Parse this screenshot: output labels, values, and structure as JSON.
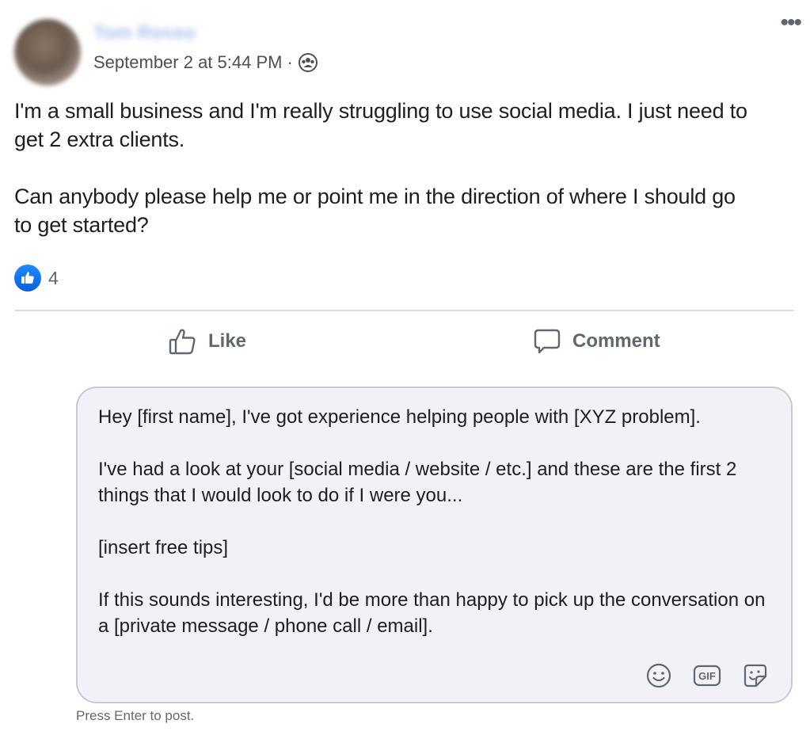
{
  "post": {
    "author_name": "Tom Rosso",
    "timestamp": "September 2 at 5:44 PM",
    "separator": "·",
    "audience_icon": "group-icon",
    "more_label": "•••",
    "paragraphs": [
      "I'm a small business and I'm really struggling to use social media. I just need to get 2 extra clients.",
      "Can anybody please help me or point me in the direction of where I should go to get started?"
    ],
    "reaction_count": "4",
    "reaction_icon": "like-reaction-icon"
  },
  "actions": {
    "like_label": "Like",
    "comment_label": "Comment"
  },
  "comment_box": {
    "paragraphs": [
      "Hey [first name], I've got experience helping people with [XYZ problem].",
      "I've had a look at your [social media / website / etc.] and these are the first 2 things that I would look to do if I were you...",
      "[insert free tips]",
      "If this sounds interesting, I'd be more than happy to pick up the conversation on a [private message / phone call / email]."
    ],
    "gif_label": "GIF",
    "hint": "Press Enter to post."
  },
  "colors": {
    "like_blue": "#1877f2",
    "secondary_text": "#606770",
    "comment_bg": "#f2f1f8"
  }
}
